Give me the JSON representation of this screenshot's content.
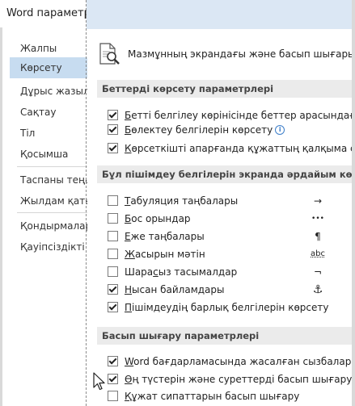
{
  "window": {
    "title": "Word параметрлері"
  },
  "sidebar": {
    "items": [
      {
        "label": "Жалпы",
        "selected": false
      },
      {
        "label": "Көрсету",
        "selected": true
      },
      {
        "label": "Дұрыс жазылу",
        "selected": false
      },
      {
        "label": "Сақтау",
        "selected": false
      },
      {
        "label": "Тіл",
        "selected": false
      },
      {
        "label": "Қосымша",
        "selected": false
      },
      {
        "label": "Таспаны теңшеу",
        "selected": false
      },
      {
        "label": "Жылдам қатынас",
        "selected": false
      },
      {
        "label": "Қондырмалар",
        "selected": false
      },
      {
        "label": "Қауіпсіздікті басқару",
        "selected": false
      }
    ]
  },
  "header": {
    "text": "Мазмұнның экрандағы және басып шығарылғандағы көрінісін өзгерту."
  },
  "sections": {
    "page_display": {
      "title": "Беттерді көрсету параметрлері",
      "options": [
        {
          "pre": "",
          "u": "Б",
          "post": "етті белгілеу көрінісінде беттер арасындағы бос орынды көрсету",
          "checked": true
        },
        {
          "pre": "",
          "u": "Б",
          "post": "өлектеу белгілерін көрсету",
          "checked": true,
          "info": "i"
        },
        {
          "pre": "",
          "u": "К",
          "post": "өрсеткішті апарғанда құжаттың қалқыма сөзкемсін көрсету",
          "checked": true
        }
      ]
    },
    "formatting_marks": {
      "title": "Бұл пішімдеу белгілерін экранда әрдайым көрсетілсін",
      "options": [
        {
          "pre": "",
          "u": "Т",
          "post": "абуляция таңбалары",
          "checked": false,
          "symbol": "→"
        },
        {
          "pre": "",
          "u": "Б",
          "post": "ос орындар",
          "checked": false,
          "symbol": "•••"
        },
        {
          "pre": "",
          "u": "Е",
          "post": "же таңбалары",
          "checked": false,
          "symbol": "¶"
        },
        {
          "pre": "",
          "u": "Ж",
          "post": "асырын мәтін",
          "checked": false,
          "symbol": "abc"
        },
        {
          "pre": "Шара",
          "u": "с",
          "post": "ыз тасымалдар",
          "checked": false,
          "symbol": "¬"
        },
        {
          "pre": "",
          "u": "Н",
          "post": "ысан байламдары",
          "checked": true,
          "symbol": "⚓"
        },
        {
          "pre": "",
          "u": "П",
          "post": "ішімдеудің барлық белгілерін көрсету",
          "checked": true
        }
      ]
    },
    "print": {
      "title": "Басып шығару параметрлері",
      "options": [
        {
          "pre": "",
          "u": "W",
          "post": "ord бағдарламасында жасалған сызбаларды басып шығару",
          "checked": true
        },
        {
          "pre": "",
          "u": "Ө",
          "post": "ң түстерін және суреттерді басып шығару",
          "checked": true
        },
        {
          "pre": "",
          "u": "Қ",
          "post": "ұжат сипаттарын басып шығару",
          "checked": false
        }
      ]
    }
  },
  "colors": {
    "selected_nav": "#c7dcf0",
    "section_bg": "#ebebeb",
    "accent": "#3d7ec9"
  }
}
